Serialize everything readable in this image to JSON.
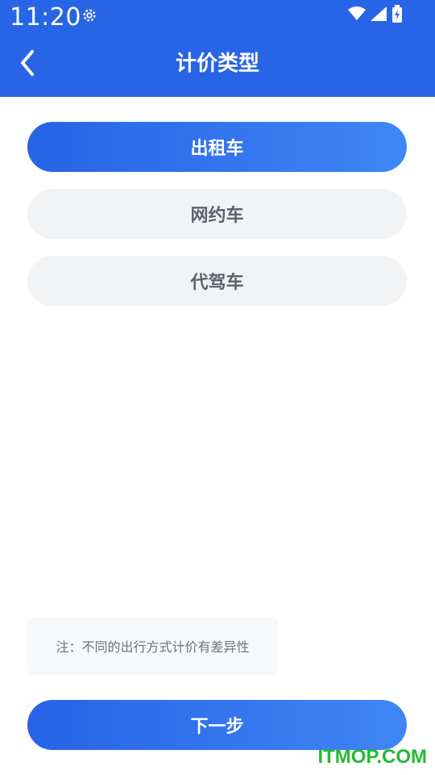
{
  "status_bar": {
    "time": "11:20",
    "icons": [
      "gear-icon",
      "wifi-icon",
      "signal-icon",
      "battery-charging-icon"
    ]
  },
  "header": {
    "title": "计价类型",
    "back_icon": "chevron-left-icon"
  },
  "options": [
    {
      "label": "出租车",
      "selected": true
    },
    {
      "label": "网约车",
      "selected": false
    },
    {
      "label": "代驾车",
      "selected": false
    }
  ],
  "note": "注：不同的出行方式计价有差异性",
  "next_button": "下一步",
  "watermark": "ITMOP.COM",
  "colors": {
    "primary": "#2865e6",
    "gradient_end": "#3f86f5",
    "option_bg": "#f2f3f5",
    "watermark": "#22bb33"
  }
}
